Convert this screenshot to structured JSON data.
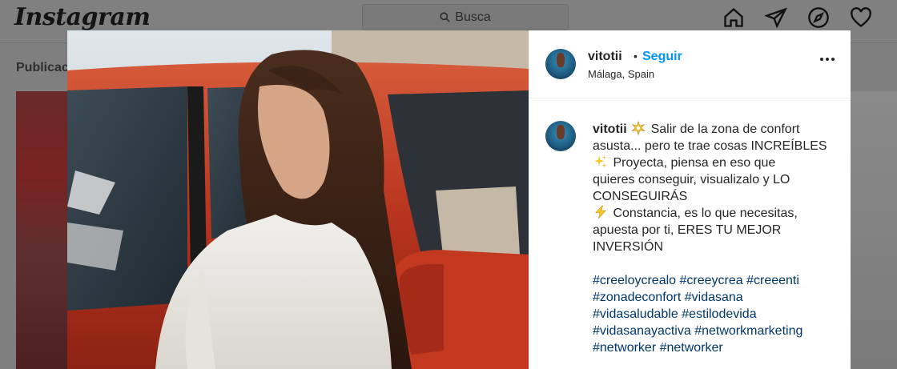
{
  "app": {
    "logo_text": "Instagram"
  },
  "search": {
    "placeholder": "Busca"
  },
  "nav": {
    "icons": [
      "home-icon",
      "direct-icon",
      "explore-icon",
      "activity-icon"
    ]
  },
  "background": {
    "tab_label": "Publicac"
  },
  "post": {
    "username": "vitotii",
    "separator": "•",
    "follow_label": "Seguir",
    "location": "Málaga, Spain",
    "caption": {
      "line1": "Salir de la zona de confort",
      "line2": "asusta... pero te trae cosas INCREÍBLES",
      "line3": "Proyecta, piensa en eso que",
      "line4": "quieres conseguir, visualizalo y LO",
      "line5": "CONSEGUIRÁS",
      "line6": "Constancia, es lo que necesitas,",
      "line7": "apuesta por ti, ERES TU MEJOR",
      "line8": "INVERSIÓN",
      "emojis": [
        "collision-icon",
        "sparkles-icon",
        "lightning-icon"
      ]
    },
    "hashtags": [
      "#creeloycrealo #creeycrea #creeenti",
      "#zonadeconfort #vidasana",
      "#vidasaludable #estilodevida",
      "#vidasanayactiva #networkmarketing",
      "#networker #networker"
    ]
  },
  "colors": {
    "link_blue": "#0095f6",
    "hashtag": "#00376b",
    "text": "#262626",
    "overlay": "#808080"
  }
}
